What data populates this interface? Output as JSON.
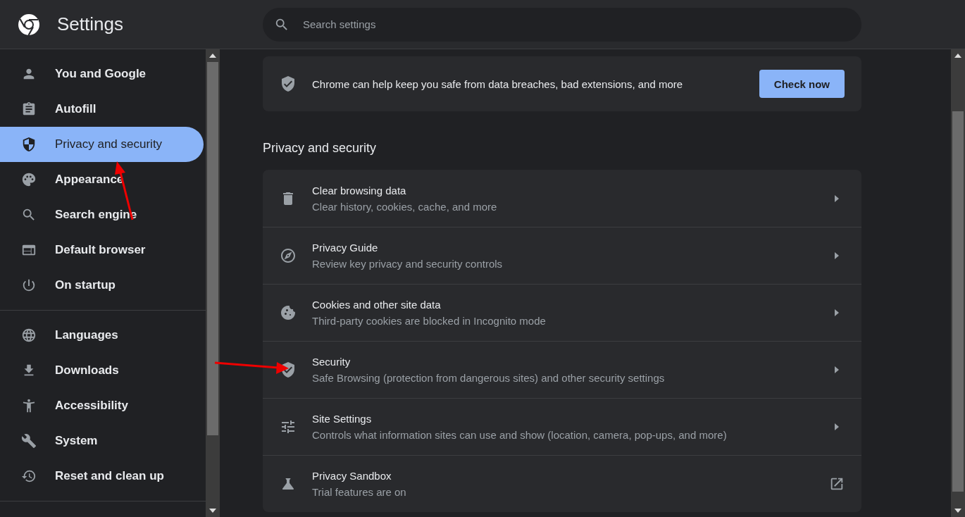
{
  "header": {
    "title": "Settings",
    "search": {
      "placeholder": "Search settings"
    }
  },
  "sidebar": {
    "groups": [
      [
        {
          "label": "You and Google",
          "selected": false
        },
        {
          "label": "Autofill",
          "selected": false
        },
        {
          "label": "Privacy and security",
          "selected": true
        },
        {
          "label": "Appearance",
          "selected": false
        },
        {
          "label": "Search engine",
          "selected": false
        },
        {
          "label": "Default browser",
          "selected": false
        },
        {
          "label": "On startup",
          "selected": false
        }
      ],
      [
        {
          "label": "Languages",
          "selected": false
        },
        {
          "label": "Downloads",
          "selected": false
        },
        {
          "label": "Accessibility",
          "selected": false
        },
        {
          "label": "System",
          "selected": false
        },
        {
          "label": "Reset and clean up",
          "selected": false
        }
      ]
    ]
  },
  "safety_check": {
    "text": "Chrome can help keep you safe from data breaches, bad extensions, and more",
    "button": "Check now"
  },
  "section": {
    "title": "Privacy and security",
    "rows": [
      {
        "kind": "subpage",
        "title": "Clear browsing data",
        "subtitle": "Clear history, cookies, cache, and more"
      },
      {
        "kind": "subpage",
        "title": "Privacy Guide",
        "subtitle": "Review key privacy and security controls"
      },
      {
        "kind": "subpage",
        "title": "Cookies and other site data",
        "subtitle": "Third-party cookies are blocked in Incognito mode"
      },
      {
        "kind": "subpage",
        "title": "Security",
        "subtitle": "Safe Browsing (protection from dangerous sites) and other security settings"
      },
      {
        "kind": "subpage",
        "title": "Site Settings",
        "subtitle": "Controls what information sites can use and show (location, camera, pop-ups, and more)"
      },
      {
        "kind": "external",
        "title": "Privacy Sandbox",
        "subtitle": "Trial features are on"
      }
    ]
  }
}
